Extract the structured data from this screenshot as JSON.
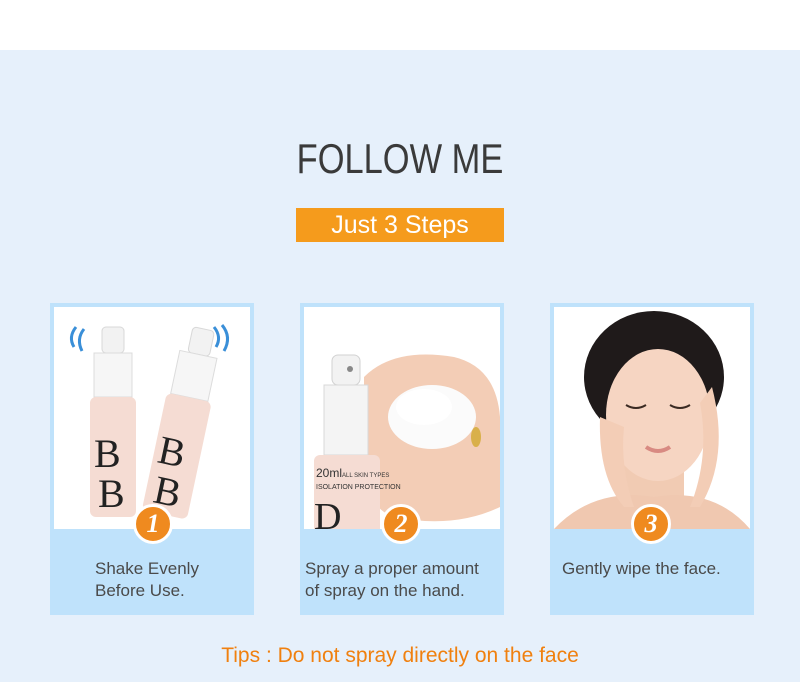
{
  "header": {
    "title": "FOLLOW ME",
    "subtitle": "Just 3 Steps"
  },
  "steps": [
    {
      "number": "1",
      "caption_line1": "Shake Evenly",
      "caption_line2": "Before Use."
    },
    {
      "number": "2",
      "caption_line1": "Spray a proper amount",
      "caption_line2": "of spray on the hand.",
      "bottle_label_line1": "20ml",
      "bottle_label_line2": "ALL SKIN TYPES",
      "bottle_label_line3": "ISOLATION PROTECTION"
    },
    {
      "number": "3",
      "caption_line1": "Gently wipe the face.",
      "caption_line2": ""
    }
  ],
  "step1_bottle_letters": "BB",
  "tips": "Tips : Do not spray directly on the face",
  "colors": {
    "accent_orange": "#f59b1c",
    "card_blue": "#bfe2fb",
    "background": "#e6f0fb"
  }
}
